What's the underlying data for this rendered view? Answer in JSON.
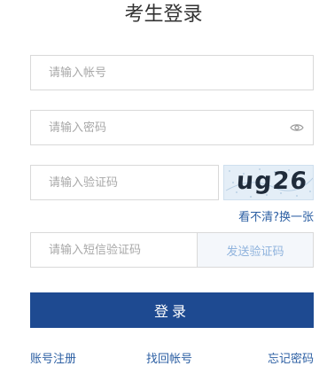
{
  "page": {
    "title": "考生登录"
  },
  "form": {
    "account_placeholder": "请输入帐号",
    "password_placeholder": "请输入密码",
    "captcha_placeholder": "请输入验证码",
    "captcha_text": "ug26",
    "refresh_captcha": "看不清?换一张",
    "sms_placeholder": "请输入短信验证码",
    "send_sms": "发送验证码",
    "login": "登录"
  },
  "links": {
    "register": "账号注册",
    "recover_account": "找回帐号",
    "forgot_password": "忘记密码"
  },
  "icons": {
    "password_toggle": "eye-icon"
  },
  "colors": {
    "primary": "#1e4a91",
    "link": "#2c5fa3",
    "border": "#d9d9d9",
    "placeholder": "#a8a8a8",
    "sms_text": "#8fb3dd",
    "captcha_bg": "#e7f1f9"
  }
}
